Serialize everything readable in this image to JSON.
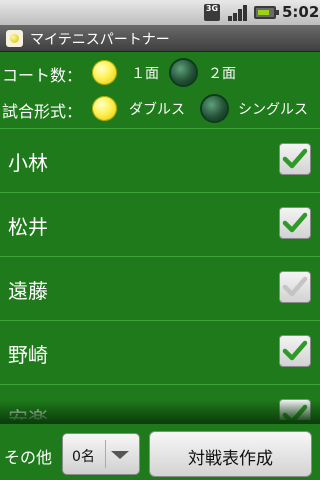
{
  "status_bar": {
    "network": "3G",
    "time": "5:02"
  },
  "app": {
    "title": "マイテニスパートナー"
  },
  "options": {
    "courts": {
      "label": "コート数：",
      "choices": [
        {
          "label": "１面",
          "selected": true
        },
        {
          "label": "２面",
          "selected": false
        }
      ]
    },
    "format": {
      "label": "試合形式：",
      "choices": [
        {
          "label": "ダブルス",
          "selected": true
        },
        {
          "label": "シングルス",
          "selected": false
        }
      ]
    }
  },
  "players": [
    {
      "name": "小林",
      "checked": true
    },
    {
      "name": "松井",
      "checked": true
    },
    {
      "name": "遠藤",
      "checked": true,
      "disabled_look": true
    },
    {
      "name": "野崎",
      "checked": true
    },
    {
      "name": "安楽",
      "checked": true
    }
  ],
  "bottom": {
    "other_label": "その他",
    "count_value": "0名",
    "create_button": "対戦表作成"
  },
  "colors": {
    "background": "#1e7a1a",
    "check": "#2e9a2a"
  }
}
